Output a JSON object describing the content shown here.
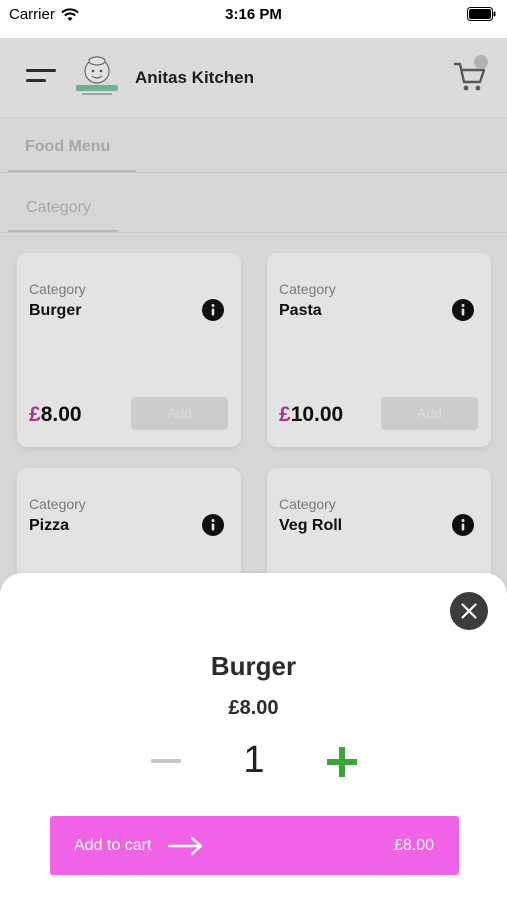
{
  "status_bar": {
    "carrier": "Carrier",
    "time": "3:16 PM"
  },
  "header": {
    "title": "Anitas Kitchen",
    "menu_icon": "hamburger-menu-icon",
    "logo_icon": "chef-logo",
    "cart_icon": "shopping-cart-icon"
  },
  "tabs": {
    "food_menu": "Food Menu",
    "category": "Category"
  },
  "products": [
    {
      "category_label": "Category",
      "name": "Burger",
      "currency": "£",
      "price": "8.00",
      "add_label": "Add"
    },
    {
      "category_label": "Category",
      "name": "Pasta",
      "currency": "£",
      "price": "10.00",
      "add_label": "Add"
    },
    {
      "category_label": "Category",
      "name": "Pizza"
    },
    {
      "category_label": "Category",
      "name": "Veg Roll"
    }
  ],
  "sheet": {
    "title": "Burger",
    "price": "£8.00",
    "quantity": "1",
    "add_to_cart_label": "Add to cart",
    "total": "£8.00"
  },
  "colors": {
    "accent_pink": "#f062e6",
    "currency_purple": "#c03ab0",
    "plus_green": "#3aa63a",
    "close_dark": "#3c3c3c"
  }
}
